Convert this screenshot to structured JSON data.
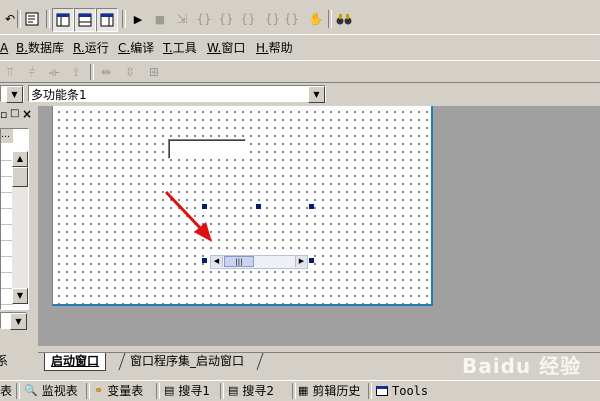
{
  "toolbar_top": {
    "icons": [
      "undo-icon",
      "find-icon",
      "layout-icon-1",
      "layout-icon-2",
      "layout-icon-3",
      "run-icon",
      "stop-icon",
      "step-icon",
      "step-in-icon",
      "step-out-icon",
      "step-over-icon",
      "braces-icon",
      "hand-icon",
      "search-binoculars-icon"
    ]
  },
  "menu": {
    "items": [
      {
        "prefix": "A",
        "label": "A"
      },
      {
        "prefix": "B.",
        "label": "数据库"
      },
      {
        "prefix": "R.",
        "label": "运行"
      },
      {
        "prefix": "C.",
        "label": "编译"
      },
      {
        "prefix": "T.",
        "label": "工具"
      },
      {
        "prefix": "W.",
        "label": "窗口"
      },
      {
        "prefix": "H.",
        "label": "帮助"
      }
    ]
  },
  "combo": {
    "value": "多功能条1"
  },
  "panel": {
    "min_glyph": "▫",
    "max_glyph": "□",
    "close_glyph": "×"
  },
  "tabs": {
    "active": "启动窗口",
    "second": "窗口程序集_启动窗口"
  },
  "statusbar": {
    "items": [
      {
        "label": "表"
      },
      {
        "label": "监视表"
      },
      {
        "label": "变量表"
      },
      {
        "label": "搜寻1"
      },
      {
        "label": "搜寻2"
      },
      {
        "label": "剪辑历史"
      },
      {
        "label": "Tools"
      }
    ]
  },
  "side_label": "系",
  "watermark": "Baidu 经验",
  "colors": {
    "desktop_gray": "#a0a0a0",
    "annotation_arrow": "#e01010",
    "selection_handle": "#0b1a6e"
  }
}
